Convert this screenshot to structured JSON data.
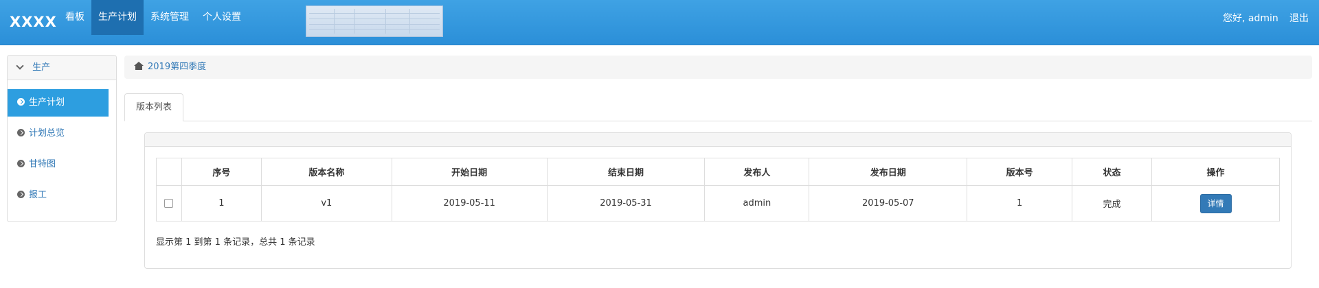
{
  "header": {
    "brand": "XXXX",
    "nav": [
      {
        "label": "看板"
      },
      {
        "label": "生产计划"
      },
      {
        "label": "系统管理"
      },
      {
        "label": "个人设置"
      }
    ],
    "greeting": "您好, admin",
    "logout": "退出"
  },
  "sidebar": {
    "title": "生产",
    "items": [
      {
        "label": "生产计划"
      },
      {
        "label": "计划总览"
      },
      {
        "label": "甘特图"
      },
      {
        "label": "报工"
      }
    ]
  },
  "breadcrumb": "2019第四季度",
  "tab": "版本列表",
  "table": {
    "columns": [
      "序号",
      "版本名称",
      "开始日期",
      "结束日期",
      "发布人",
      "发布日期",
      "版本号",
      "状态",
      "操作"
    ],
    "rows": [
      {
        "no": "1",
        "name": "v1",
        "start": "2019-05-11",
        "end": "2019-05-31",
        "publisher": "admin",
        "publish_date": "2019-05-07",
        "version": "1",
        "status": "完成",
        "action": "详情"
      }
    ]
  },
  "pagination_info": "显示第 1 到第 1 条记录，总共 1 条记录",
  "colors": {
    "navbar": "#2b8fd8",
    "nav_active": "#1e6fb0",
    "sidebar_active": "#2d9ee0",
    "link": "#337ab7",
    "status_done": "#f0ad4e",
    "button": "#337ab7"
  }
}
